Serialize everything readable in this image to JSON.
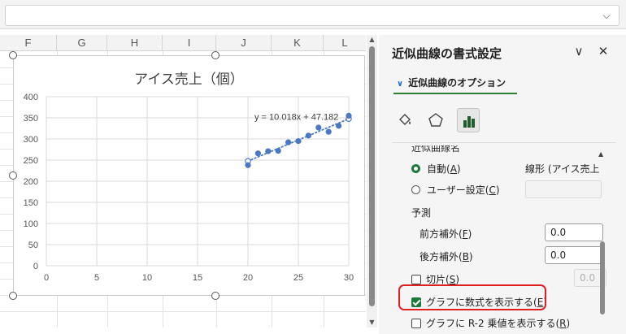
{
  "formula_bar": {
    "expand_icon": "chevron-down-icon",
    "expand_glyph": "⌵"
  },
  "sheet": {
    "columns": [
      "F",
      "G",
      "H",
      "I",
      "J",
      "K",
      "L"
    ]
  },
  "chart_data": {
    "type": "scatter",
    "title": "アイス売上（個）",
    "xlabel": "",
    "ylabel": "",
    "xlim": [
      0,
      30
    ],
    "ylim": [
      0,
      400
    ],
    "x_ticks": [
      "0",
      "5",
      "10",
      "15",
      "20",
      "25",
      "30"
    ],
    "y_ticks": [
      "0",
      "50",
      "100",
      "150",
      "200",
      "250",
      "300",
      "350",
      "400"
    ],
    "grid": true,
    "series": [
      {
        "x": [
          20,
          21,
          22,
          23,
          24,
          25,
          26,
          27,
          28,
          29,
          30
        ],
        "y": [
          238,
          266,
          271,
          272,
          292,
          295,
          308,
          327,
          317,
          331,
          355
        ]
      }
    ],
    "trendline": {
      "type": "linear",
      "slope": 10.018,
      "intercept": 47.182,
      "x_range": [
        20,
        30
      ],
      "equation_label": "y = 10.018x + 47.182"
    },
    "colors": {
      "marker": "#4a78c2",
      "trendline": "#4a78c2",
      "grid": "#d9d9d9"
    }
  },
  "pane": {
    "title": "近似曲線の書式設定",
    "dropdown_glyph": "∨",
    "close_glyph": "✕",
    "section": "近似曲線のオプション",
    "section_chevron": "∨",
    "accent_color": "#2e7d32",
    "tabs": [
      "fill-bucket-icon",
      "pentagon-icon",
      "bar-chart-icon"
    ],
    "options": {
      "cut_label": "近似曲線名",
      "auto_prefix": "自動(",
      "auto_key": "A",
      "auto_suffix": ")",
      "auto_value": "線形 (アイス売上",
      "custom_prefix": "ユーザー設定(",
      "custom_key": "C",
      "custom_suffix": ")",
      "forecast_header": "予測",
      "forward_prefix": "前方補外(",
      "forward_key": "F",
      "forward_suffix": ")",
      "forward_value": "0.0",
      "backward_prefix": "後方補外(",
      "backward_key": "B",
      "backward_suffix": ")",
      "backward_value": "0.0",
      "intercept_prefix": "切片(",
      "intercept_key": "S",
      "intercept_suffix": ")",
      "intercept_value": "0.0",
      "show_equation_prefix": "グラフに数式を表示する(",
      "show_equation_key": "E",
      "show_equation_suffix": ")",
      "show_equation_checked": true,
      "show_r2_prefix": "グラフに R-2 乗値を表示する(",
      "show_r2_key": "R",
      "show_r2_suffix": ")",
      "show_r2_checked": false
    },
    "scroll_up_glyph": "▲"
  }
}
